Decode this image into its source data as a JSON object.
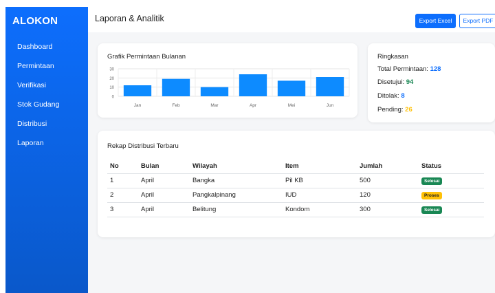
{
  "sidebar": {
    "brand": "ALOKON",
    "items": [
      "Dashboard",
      "Permintaan",
      "Verifikasi",
      "Stok Gudang",
      "Distribusi",
      "Laporan"
    ]
  },
  "header": {
    "title": "Laporan & Analitik",
    "export_excel_label": "Export Excel",
    "export_pdf_label": "Export PDF"
  },
  "chart_data": {
    "type": "bar",
    "title": "Grafik Permintaan Bulanan",
    "categories": [
      "Jan",
      "Feb",
      "Mar",
      "Apr",
      "Mei",
      "Jun"
    ],
    "values": [
      12,
      19,
      10,
      24,
      17,
      21
    ],
    "ylim": [
      0,
      30
    ],
    "yticks": [
      "0",
      "10",
      "20",
      "30"
    ],
    "grid": true,
    "bar_color": "#0d8bff"
  },
  "summary": {
    "title": "Ringkasan",
    "items": [
      {
        "label": "Total Permintaan:",
        "value": "128",
        "color": "#0d6efd"
      },
      {
        "label": "Disetujui:",
        "value": "94",
        "color": "#198754"
      },
      {
        "label": "Ditolak:",
        "value": "8",
        "color": "#0d6efd"
      },
      {
        "label": "Pending:",
        "value": "26",
        "color": "#ffc107"
      }
    ]
  },
  "table": {
    "title": "Rekap Distribusi Terbaru",
    "headers": [
      "No",
      "Bulan",
      "Wilayah",
      "Item",
      "Jumlah",
      "Status"
    ],
    "rows": [
      [
        "1",
        "April",
        "Bangka",
        "Pil KB",
        "500",
        "Selesai"
      ],
      [
        "2",
        "April",
        "Pangkalpinang",
        "IUD",
        "120",
        "Proses"
      ],
      [
        "3",
        "April",
        "Belitung",
        "Kondom",
        "300",
        "Selesai"
      ]
    ],
    "status_colors": {
      "Selesai": "#198754",
      "Proses": "#ffc107"
    }
  }
}
